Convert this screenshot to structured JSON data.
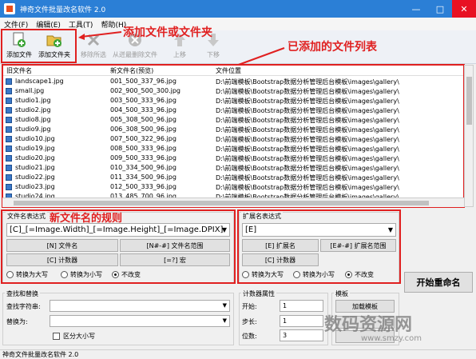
{
  "window": {
    "title": "神奇文件批量改名软件 2.0"
  },
  "menu": [
    "文件(F)",
    "编辑(E)",
    "工具(T)",
    "帮助(H)"
  ],
  "toolbar": {
    "add_file": "添加文件",
    "add_folder": "添加文件夹",
    "remove_selected": "移除所选",
    "remove_all": "从迸最删除文件",
    "move_up": "上移",
    "move_down": "下移"
  },
  "annotations": {
    "toolbar_note": "添加文件或文件夹",
    "list_note": "已添加的文件列表",
    "rule_note": "新文件名的规则"
  },
  "file_list": {
    "headers": {
      "old_name": "旧文件名",
      "new_name": "新文件名(预览)",
      "location": "文件位置"
    },
    "rows": [
      {
        "old": "landscape1.jpg",
        "new": "001_500_337_96.jpg",
        "path": "D:\\前端模板\\Bootstrap数据分析管理后台模板\\images\\gallery\\"
      },
      {
        "old": "small.jpg",
        "new": "002_900_500_300.jpg",
        "path": "D:\\前端模板\\Bootstrap数据分析管理后台模板\\images\\gallery\\"
      },
      {
        "old": "studio1.jpg",
        "new": "003_500_333_96.jpg",
        "path": "D:\\前端模板\\Bootstrap数据分析管理后台模板\\images\\gallery\\"
      },
      {
        "old": "studio2.jpg",
        "new": "004_500_333_96.jpg",
        "path": "D:\\前端模板\\Bootstrap数据分析管理后台模板\\images\\gallery\\"
      },
      {
        "old": "studio8.jpg",
        "new": "005_308_500_96.jpg",
        "path": "D:\\前端模板\\Bootstrap数据分析管理后台模板\\images\\gallery\\"
      },
      {
        "old": "studio9.jpg",
        "new": "006_308_500_96.jpg",
        "path": "D:\\前端模板\\Bootstrap数据分析管理后台模板\\images\\gallery\\"
      },
      {
        "old": "studio10.jpg",
        "new": "007_500_322_96.jpg",
        "path": "D:\\前端模板\\Bootstrap数据分析管理后台模板\\images\\gallery\\"
      },
      {
        "old": "studio19.jpg",
        "new": "008_500_333_96.jpg",
        "path": "D:\\前端模板\\Bootstrap数据分析管理后台模板\\images\\gallery\\"
      },
      {
        "old": "studio20.jpg",
        "new": "009_500_333_96.jpg",
        "path": "D:\\前端模板\\Bootstrap数据分析管理后台模板\\images\\gallery\\"
      },
      {
        "old": "studio21.jpg",
        "new": "010_334_500_96.jpg",
        "path": "D:\\前端模板\\Bootstrap数据分析管理后台模板\\images\\gallery\\"
      },
      {
        "old": "studio22.jpg",
        "new": "011_334_500_96.jpg",
        "path": "D:\\前端模板\\Bootstrap数据分析管理后台模板\\images\\gallery\\"
      },
      {
        "old": "studio23.jpg",
        "new": "012_500_333_96.jpg",
        "path": "D:\\前端模板\\Bootstrap数据分析管理后台模板\\images\\gallery\\"
      },
      {
        "old": "studio24.jpg",
        "new": "013_485_700_96.jpg",
        "path": "D:\\前端模板\\Bootstrap数据分析管理后台模板\\images\\gallery\\"
      }
    ]
  },
  "filename_expr": {
    "label": "文件名表达式",
    "value": "[C]_[=Image.Width]_[=Image.Height]_[=Image.DPIX]",
    "btn_filename": "[N] 文件名",
    "btn_range": "[N#-#] 文件名范围",
    "btn_counter": "[C] 计数器",
    "btn_macro": "[=?] 宏",
    "radio_upper": "转换为大写",
    "radio_lower": "转换为小写",
    "radio_keep": "不改变"
  },
  "ext_expr": {
    "label": "扩展名表达式",
    "value": "[E]",
    "btn_ext": "[E] 扩展名",
    "btn_range": "[E#-#] 扩展名范围",
    "btn_counter": "[C] 计数器",
    "radio_upper": "转换为大写",
    "radio_lower": "转换为小写",
    "radio_keep": "不改变"
  },
  "start_button": "开始重命名",
  "find_replace": {
    "label": "查找和替换",
    "find_label": "查找字符串:",
    "replace_label": "替换为:",
    "case_label": "区分大小写"
  },
  "counter": {
    "label": "计数器属性",
    "start_label": "开始:",
    "start_value": "1",
    "step_label": "步长:",
    "step_value": "1",
    "digits_label": "位数:",
    "digits_value": "3"
  },
  "template": {
    "label": "模板",
    "load_button": "加载模板"
  },
  "status": "神奇文件批量改名软件 2.0",
  "watermark": {
    "main": "数码资源网",
    "url": "www.smzy.com"
  }
}
